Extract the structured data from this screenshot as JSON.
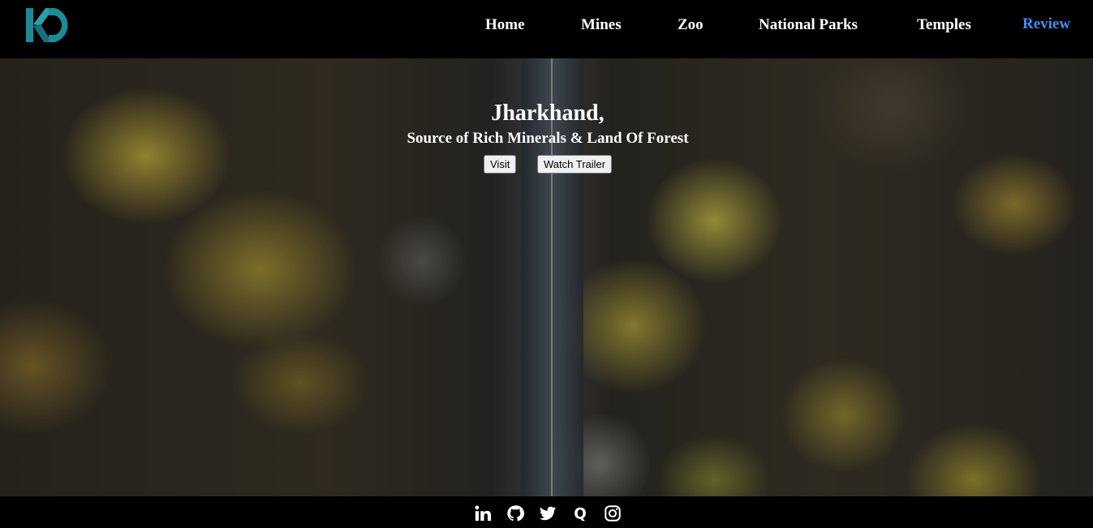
{
  "brand": {
    "logo_icon": "kd-logo-icon",
    "accent": "#1e8a94"
  },
  "nav": {
    "items": [
      {
        "label": "Home"
      },
      {
        "label": "Mines"
      },
      {
        "label": "Zoo"
      },
      {
        "label": "National Parks"
      },
      {
        "label": "Temples"
      },
      {
        "label": "Review"
      }
    ],
    "active_color": "#3d8ff0"
  },
  "hero": {
    "title": "Jharkhand,",
    "subtitle": "Source of Rich Minerals & Land Of Forest",
    "visit_label": "Visit",
    "trailer_label": "Watch Trailer",
    "background": "aerial-forest-road-image"
  },
  "footer": {
    "social": [
      "linkedin-icon",
      "github-icon",
      "twitter-icon",
      "quora-icon",
      "instagram-icon"
    ]
  }
}
